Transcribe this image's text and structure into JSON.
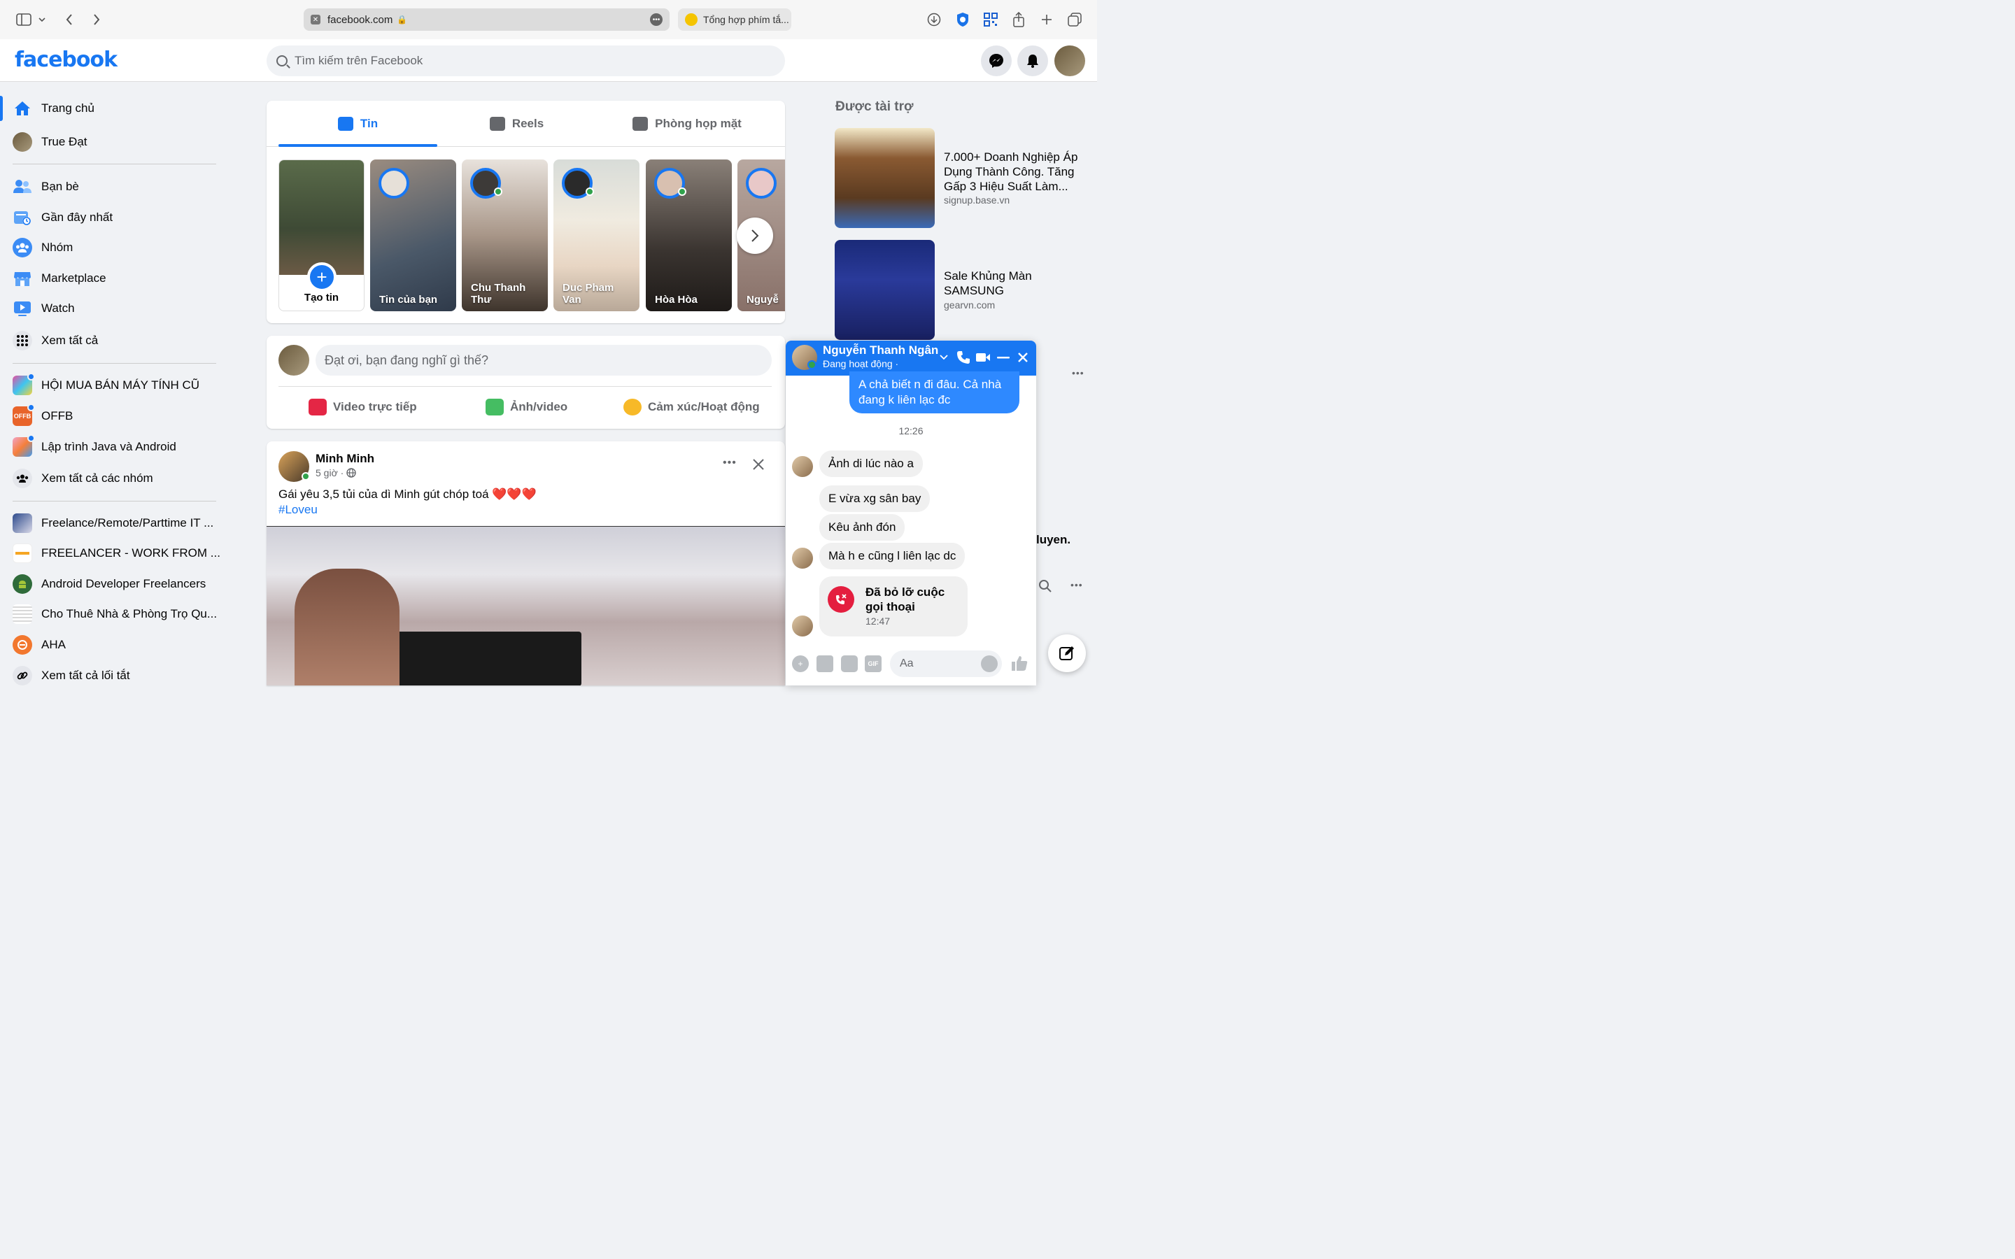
{
  "browser": {
    "url": "facebook.com",
    "second_tab": "Tổng hợp phím tắ..."
  },
  "header": {
    "logo": "facebook",
    "search_placeholder": "Tìm kiếm trên Facebook"
  },
  "sidebar": {
    "items": [
      {
        "label": "Trang chủ",
        "icon": "home-icon"
      },
      {
        "label": "True Đạt",
        "icon": "profile-avatar"
      },
      {
        "label": "Bạn bè",
        "icon": "friends-icon"
      },
      {
        "label": "Gần đây nhất",
        "icon": "recent-icon"
      },
      {
        "label": "Nhóm",
        "icon": "groups-icon"
      },
      {
        "label": "Marketplace",
        "icon": "marketplace-icon"
      },
      {
        "label": "Watch",
        "icon": "watch-icon"
      },
      {
        "label": "Xem tất cả",
        "icon": "grid-icon"
      }
    ],
    "groups": [
      {
        "label": "HỘI MUA BÁN MÁY TÍNH CŨ"
      },
      {
        "label": "OFFB"
      },
      {
        "label": "Lập trình Java và Android"
      },
      {
        "label": "Xem tất cả các nhóm"
      }
    ],
    "shortcuts": [
      {
        "label": "Freelance/Remote/Parttime IT ..."
      },
      {
        "label": "FREELANCER - WORK FROM ..."
      },
      {
        "label": "Android Developer Freelancers"
      },
      {
        "label": "Cho Thuê Nhà & Phòng Trọ Qu..."
      },
      {
        "label": "AHA"
      },
      {
        "label": "Xem tất cả lối tắt"
      }
    ]
  },
  "feed": {
    "tabs": [
      {
        "label": "Tin"
      },
      {
        "label": "Reels"
      },
      {
        "label": "Phòng họp mặt"
      }
    ],
    "create_story_label": "Tạo tin",
    "stories": [
      {
        "name": "Tin của bạn"
      },
      {
        "name": "Chu Thanh Thư"
      },
      {
        "name": "Duc Pham Van"
      },
      {
        "name": "Hòa Hòa"
      },
      {
        "name": "Nguyễn Phương"
      }
    ],
    "composer": {
      "placeholder": "Đạt ơi, bạn đang nghĩ gì thế?",
      "live_label": "Video trực tiếp",
      "photo_label": "Ảnh/video",
      "feeling_label": "Cảm xúc/Hoạt động"
    },
    "post": {
      "author": "Minh Minh",
      "time": "5 giờ ·",
      "text": "Gái yêu 3,5 tủi của dì Minh gút chóp toá ❤️❤️❤️",
      "hashtag": "#Loveu"
    }
  },
  "sponsored": {
    "heading": "Được tài trợ",
    "ads": [
      {
        "title": "7.000+ Doanh Nghiệp Áp Dụng Thành Công. Tăng Gấp 3 Hiệu Suất Làm...",
        "url": "signup.base.vn"
      },
      {
        "title": "Sale Khủng Màn SAMSUNG",
        "url": "gearvn.com"
      }
    ],
    "partial_text": "luyen."
  },
  "chat": {
    "name": "Nguyễn Thanh Ngân",
    "status": "Đang hoạt động ·",
    "messages": {
      "sent_1": "A chả biết n đi đâu. Cả nhà đang k liên lạc đc",
      "time_1": "12:26",
      "recv_1": "Ảnh di lúc nào a",
      "recv_2": "E vừa xg sân bay",
      "recv_3": "Kêu ảnh đón",
      "recv_4": "Mà h e cũng l liên lạc dc",
      "missed_call": "Đã bỏ lỡ cuộc gọi thoại",
      "missed_time": "12:47"
    },
    "input_placeholder": "Aa"
  },
  "colors": {
    "brand": "#1877f2",
    "online": "#31a24c",
    "missed_call": "#e41e3f"
  }
}
